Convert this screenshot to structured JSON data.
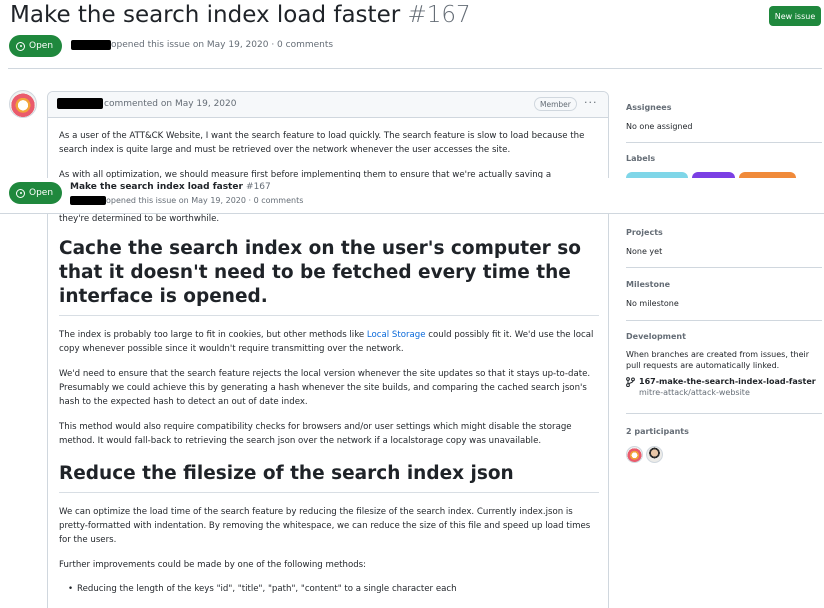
{
  "issue": {
    "title": "Make the search index load faster",
    "number": "#167",
    "state": "Open",
    "meta": "opened this issue on May 19, 2020 · 0 comments"
  },
  "header": {
    "new_issue_label": "New issue"
  },
  "comment": {
    "meta": "commented on May 19, 2020",
    "role_badge": "Member",
    "menu_icon": "···",
    "p1": "As a user of the ATT&CK Website, I want the search feature to load quickly. The search feature is slow to load because the search index is quite large and must be retrieved over the network whenever the user accesses the site.",
    "p2": "As with all optimization, we should measure first before implementing them to ensure that we're actually saving a",
    "p3": "they're determined to be worthwhile.",
    "h1": "Cache the search index on the user's computer so that it doesn't need to be fetched every time the interface is opened.",
    "p4_a": "The index is probably too large to fit in cookies, but other methods like ",
    "p4_link": "Local Storage",
    "p4_b": " could possibly fit it. We'd use the local copy whenever possible since it wouldn't require transmitting over the network.",
    "p5": "We'd need to ensure that the search feature rejects the local version whenever the site updates so that it stays up-to-date. Presumably we could achieve this by generating a hash whenever the site builds, and comparing the cached search json's hash to the expected hash to detect an out of date index.",
    "p6": "This method would also require compatibility checks for browsers and/or user settings which might disable the storage method. It would fall-back to retrieving the search json over the network if a localstorage copy was unavailable.",
    "h2": "Reduce the filesize of the search index json",
    "p7": "We can optimize the load time of the search feature by reducing the filesize of the search index. Currently index.json is pretty-formatted with indentation. By removing the whitespace, we can reduce the size of this file and speed up load times for the users.",
    "p8": "Further improvements could be made by one of the following methods:",
    "li1": "Reducing the length of the keys \"id\", \"title\", \"path\", \"content\" to a single character each"
  },
  "sidebar": {
    "assignees_h": "Assignees",
    "assignees_v": "No one assigned",
    "labels_h": "Labels",
    "projects_h": "Projects",
    "projects_v": "None yet",
    "milestone_h": "Milestone",
    "milestone_v": "No milestone",
    "development_h": "Development",
    "development_v": "When branches are created from issues, their pull requests are automatically linked.",
    "branch_name": "167-make-the-search-index-load-faster",
    "branch_repo": "mitre-attack/attack-website",
    "participants_h": "2 participants"
  },
  "colors": {
    "open_green": "#1f883d",
    "link_blue": "#0969da",
    "label_teal": "#7fd6e8",
    "label_purple": "#7b3fe4",
    "label_orange": "#f08a3a"
  },
  "icons": [
    "open-issue-icon",
    "kebab-menu-icon",
    "git-branch-icon"
  ]
}
